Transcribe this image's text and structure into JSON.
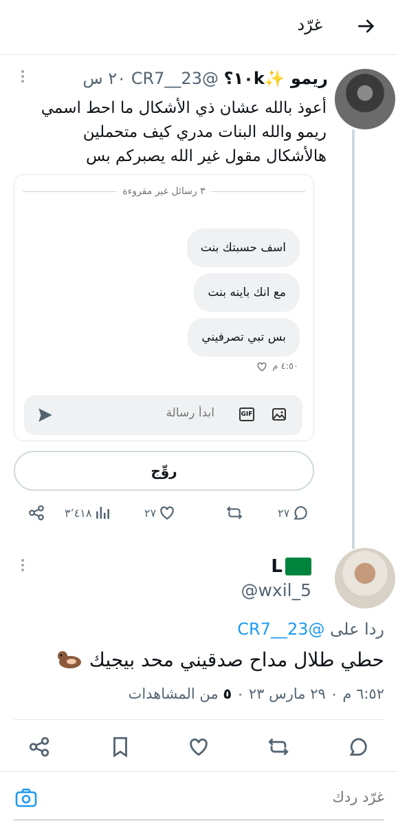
{
  "header": {
    "title": "غرّد",
    "back_icon": "arrow-right-icon"
  },
  "tweet1": {
    "name": "ريمو ✨١٠k؟",
    "handle": "@CR7__23",
    "time": "٢٠ س",
    "text": "أعوذ بالله عشان ذي الأشكال ما احط اسمي ريمو والله البنات مدري كيف متحملين هالأشكال مقول غير الله يصبركم بس",
    "dm": {
      "unread_label": "٣ رسائل غير مقروءة",
      "messages": [
        "اسف حسبتك بنت",
        "مع انك باينه بنت",
        "بس تبي تصرفيني"
      ],
      "time": "٤:٥٠ م",
      "compose_placeholder": "ابدأ رسالة",
      "gif_label": "GIF"
    },
    "reply_button": "روِّج",
    "stats": {
      "replies": "٢٧",
      "likes": "٢٧",
      "views": "٣٬٤١٨"
    }
  },
  "tweet2": {
    "name": "L",
    "handle": "@wxil_5",
    "replying_prefix": "ردا على",
    "replying_to": "@CR7__23",
    "text": "حطي طلال مداح صدقيني محد بيجيك",
    "meta_prefix": "٦:٥٢ م ٠ ٢٩ مارس ٢٣ ٠",
    "views_count": "٥",
    "views_label": "من المشاهدات"
  },
  "composer": {
    "placeholder": "غرّد ردك"
  },
  "colors": {
    "accent": "#1d9bf0",
    "muted": "#536471",
    "flag_green": "#00843d"
  }
}
